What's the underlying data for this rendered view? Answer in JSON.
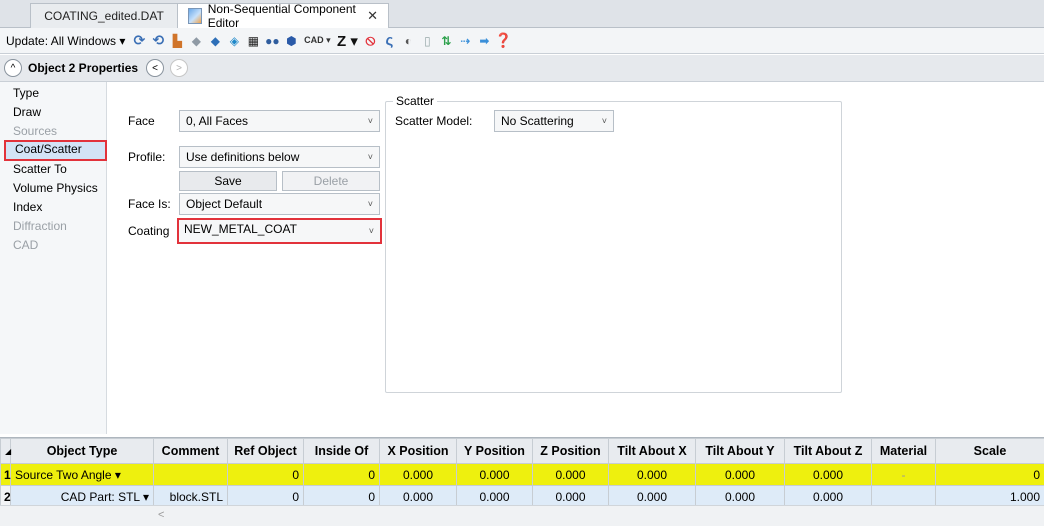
{
  "tabs": [
    {
      "label": "COATING_edited.DAT"
    },
    {
      "label": "Non-Sequential Component Editor",
      "close": "✕"
    }
  ],
  "toolbar": {
    "update_label": "Update: All Windows ▾",
    "cad_label": "CAD ▾",
    "z_label": "Z ▾"
  },
  "object_bar": {
    "title": "Object  2 Properties",
    "prev": "<",
    "next": ">",
    "collapse": "^"
  },
  "nav": {
    "items": [
      {
        "label": "Type"
      },
      {
        "label": "Draw"
      },
      {
        "label": "Sources"
      },
      {
        "label": "Coat/Scatter"
      },
      {
        "label": "Scatter To"
      },
      {
        "label": "Volume Physics"
      },
      {
        "label": "Index"
      },
      {
        "label": "Diffraction"
      },
      {
        "label": "CAD"
      }
    ]
  },
  "form": {
    "face_label": "Face",
    "face_value": "0, All Faces",
    "profile_label": "Profile:",
    "profile_value": "Use definitions below",
    "save_label": "Save",
    "delete_label": "Delete",
    "face_is_label": "Face Is:",
    "face_is_value": "Object Default",
    "coating_label": "Coating",
    "coating_value": "NEW_METAL_COAT"
  },
  "scatter": {
    "legend": "Scatter",
    "model_label": "Scatter Model:",
    "model_value": "No Scattering"
  },
  "grid": {
    "headers": [
      "Object Type",
      "Comment",
      "Ref Object",
      "Inside Of",
      "X Position",
      "Y Position",
      "Z Position",
      "Tilt About X",
      "Tilt About Y",
      "Tilt About Z",
      "Material",
      "Scale"
    ],
    "rows": [
      {
        "num": "1",
        "type": "Source Two Angle ▾",
        "comment": "",
        "ref": "0",
        "inside": "0",
        "x": "0.000",
        "y": "0.000",
        "z": "0.000",
        "tx": "0.000",
        "ty": "0.000",
        "tz": "0.000",
        "material": "-",
        "scale": "0"
      },
      {
        "num": "2",
        "type": "CAD Part: STL ▾",
        "comment": "block.STL",
        "ref": "0",
        "inside": "0",
        "x": "0.000",
        "y": "0.000",
        "z": "0.000",
        "tx": "0.000",
        "ty": "0.000",
        "tz": "0.000",
        "material": "",
        "scale": "1.000"
      }
    ],
    "scroll_left": "<"
  }
}
